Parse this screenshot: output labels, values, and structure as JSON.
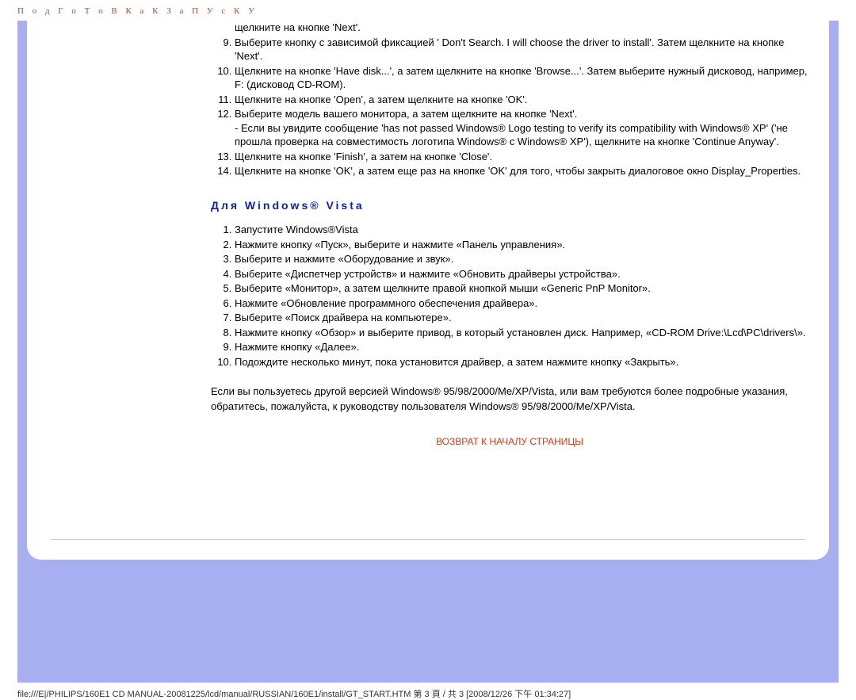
{
  "header": {
    "title": "П о д Г о Т о В К а  К  З а П У с К У"
  },
  "xp_list": {
    "partial_8": "щелкните на кнопке 'Next'.",
    "item_9": "Выберите кнопку с зависимой фиксацией ' Don't Search. I will choose the driver to install'. Затем щелкните на кнопке 'Next'.",
    "item_10": "Щелкните на кнопке 'Have disk...', а затем щелкните на кнопке 'Browse...'. Затем выберите нужный дисковод, например, F: (дисковод CD-ROM).",
    "item_11": "Щелкните на кнопке 'Open', а затем щелкните на кнопке 'OK'.",
    "item_12": "Выберите модель вашего монитора, а затем щелкните на кнопке 'Next'.",
    "item_12_sub": "- Если вы увидите сообщение 'has not passed Windows® Logo testing to verify its compatibility with Windows® XP' ('не прошла проверка на совместимость логотипа Windows® с Windows® XP'), щелкните на кнопке 'Continue Anyway'.",
    "item_13": "Щелкните на кнопке 'Finish', а затем на кнопке 'Close'.",
    "item_14": "Щелкните на кнопке 'OK', а затем еще раз на кнопке 'OK' для того, чтобы закрыть диалоговое окно Display_Properties."
  },
  "vista_heading": "Для Windows® Vista",
  "vista_list": {
    "i1": "Запустите Windows®Vista",
    "i2": "Нажмите кнопку «Пуск», выберите и нажмите «Панель управления».",
    "i3": "Выберите и нажмите «Оборудование и звук».",
    "i4": "Выберите «Диспетчер устройств» и нажмите «Обновить драйверы устройства».",
    "i5": "Выберите «Монитор», а затем щелкните правой кнопкой мыши «Generic PnP Monitor».",
    "i6": "Нажмите «Обновление программного обеспечения драйвера».",
    "i7": "Выберите «Поиск драйвера на компьютере».",
    "i8": "Нажмите кнопку «Обзор» и выберите привод, в который установлен диск. Например, «CD-ROM Drive:\\Lcd\\PC\\drivers\\».",
    "i9": "Нажмите кнопку «Далее».",
    "i10": "Подождите несколько минут, пока установится драйвер, а затем нажмите кнопку «Закрыть»."
  },
  "paragraph": "Если вы пользуетесь другой версией Windows® 95/98/2000/Me/XP/Vista, или вам требуются более подробные указания,  обратитесь, пожалуйста, к руководству пользователя Windows® 95/98/2000/Me/XP/Vista.",
  "backlink": "ВОЗВРАТ К НАЧАЛУ СТРАНИЦЫ",
  "footer": "file:///E|/PHILIPS/160E1 CD MANUAL-20081225/lcd/manual/RUSSIAN/160E1/install/GT_START.HTM 第 3 頁 / 共 3 [2008/12/26 下午 01:34:27]"
}
